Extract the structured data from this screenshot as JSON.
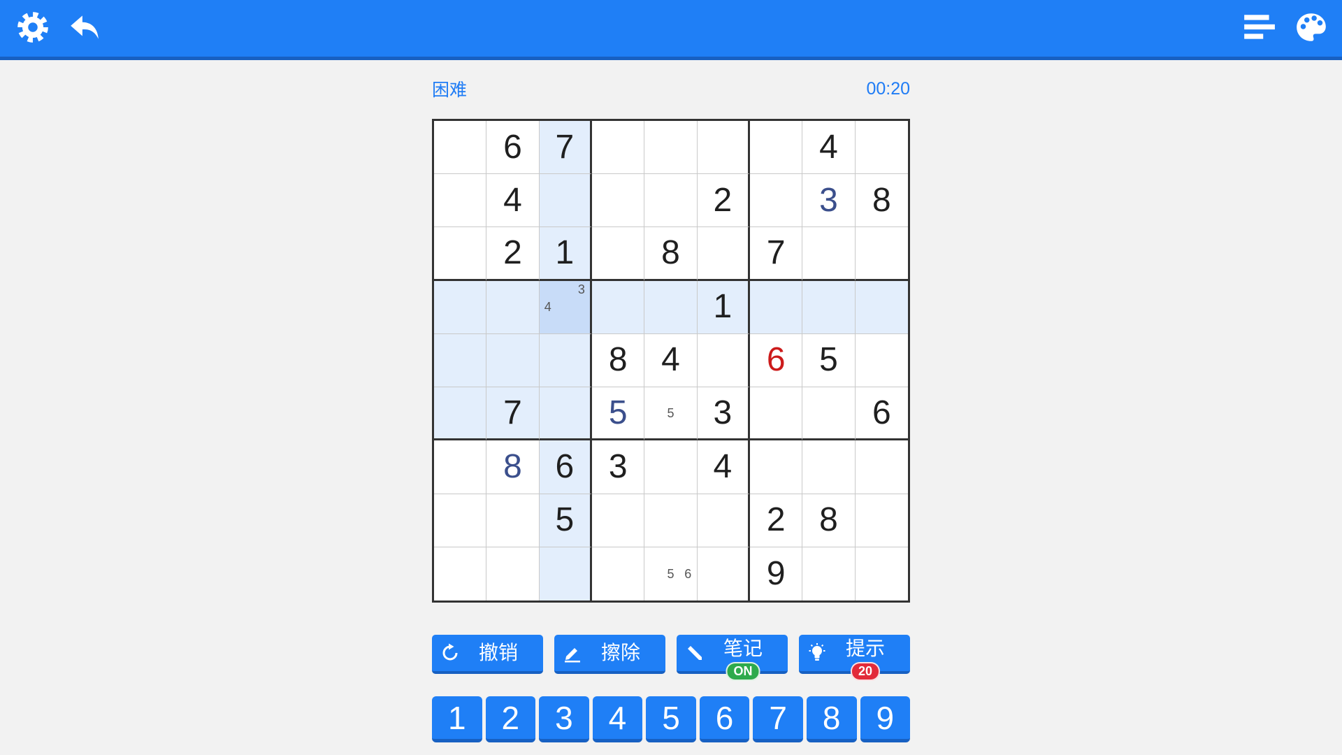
{
  "header": {
    "icons": {
      "settings": "gear-icon",
      "back": "undo-arrow-icon",
      "stats": "bar-chart-icon",
      "theme": "palette-icon"
    }
  },
  "game": {
    "difficulty": "困难",
    "timer": "00:20"
  },
  "board": {
    "rows": [
      [
        "",
        "6",
        "7",
        "",
        "",
        "",
        "",
        "4",
        ""
      ],
      [
        "",
        "4",
        "",
        "",
        "",
        "2",
        "",
        "3",
        "8"
      ],
      [
        "",
        "2",
        "1",
        "",
        "8",
        "",
        "7",
        "",
        ""
      ],
      [
        "",
        "",
        "",
        "",
        "",
        "1",
        "",
        "",
        ""
      ],
      [
        "",
        "",
        "",
        "8",
        "4",
        "",
        "6",
        "5",
        ""
      ],
      [
        "",
        "7",
        "",
        "5",
        "",
        "3",
        "",
        "",
        "6"
      ],
      [
        "",
        "8",
        "6",
        "3",
        "",
        "4",
        "",
        "",
        ""
      ],
      [
        "",
        "",
        "5",
        "",
        "",
        "",
        "2",
        "8",
        ""
      ],
      [
        "",
        "",
        "",
        "",
        "",
        "",
        "9",
        "",
        ""
      ]
    ],
    "user_entries": [
      [
        1,
        7
      ],
      [
        5,
        3
      ],
      [
        6,
        1
      ]
    ],
    "errors": [
      [
        4,
        6
      ]
    ],
    "notes": [
      {
        "row": 3,
        "col": 2,
        "digits": [
          "3",
          "4"
        ]
      },
      {
        "row": 5,
        "col": 4,
        "digits": [
          "5"
        ]
      },
      {
        "row": 8,
        "col": 4,
        "digits": [
          "5",
          "6"
        ]
      }
    ],
    "selected": {
      "row": 3,
      "col": 2
    }
  },
  "actions": [
    {
      "label": "撤销",
      "icon": "refresh-icon"
    },
    {
      "label": "擦除",
      "icon": "eraser-icon"
    },
    {
      "label": "笔记",
      "icon": "pencil-icon",
      "badge": "ON"
    },
    {
      "label": "提示",
      "icon": "lightbulb-icon",
      "badge": "20"
    }
  ],
  "numpad": [
    "1",
    "2",
    "3",
    "4",
    "5",
    "6",
    "7",
    "8",
    "9"
  ],
  "colors": {
    "accent": "#1f7ff6",
    "accent-dark": "#1760c2",
    "given": "#1f1f1f",
    "user": "#3b4f8c",
    "error": "#cc1b1b",
    "hl": "#e3eefc",
    "sel": "#c8dcf8",
    "bg": "#f2f2f2",
    "on": "#2eaa4c",
    "hint": "#e22a3a",
    "label": "#1f7cf5"
  }
}
